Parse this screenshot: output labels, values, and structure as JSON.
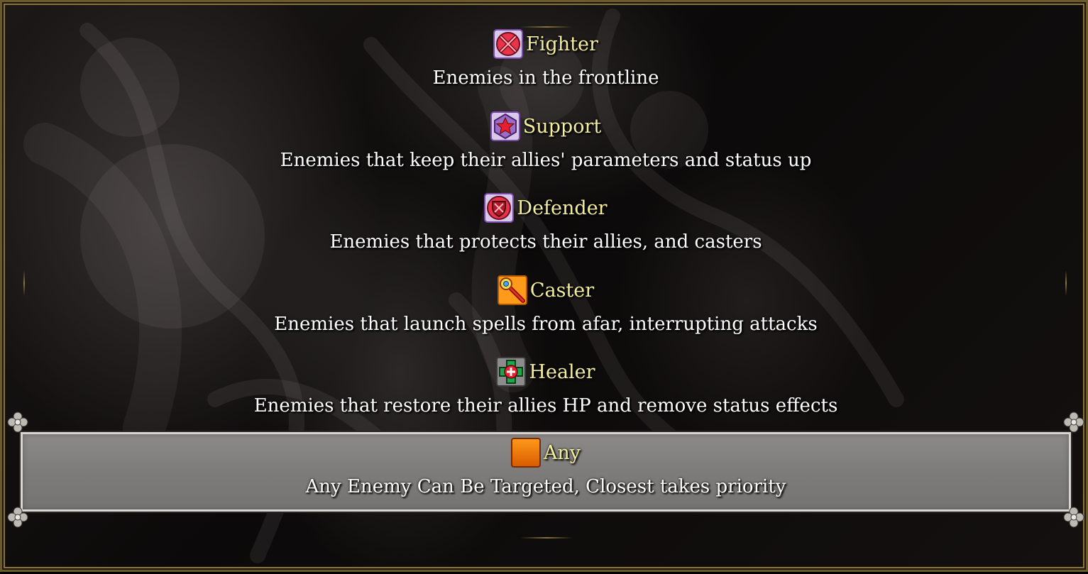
{
  "options": [
    {
      "title": "Fighter",
      "description": "Enemies in the frontline",
      "icon": "crossed-swords-icon",
      "selected": false
    },
    {
      "title": "Support",
      "description": "Enemies that keep their allies' parameters and status up",
      "icon": "star-emblem-icon",
      "selected": false
    },
    {
      "title": "Defender",
      "description": "Enemies that protects their allies, and casters",
      "icon": "shield-icon",
      "selected": false
    },
    {
      "title": "Caster",
      "description": "Enemies that launch spells from afar, interrupting attacks",
      "icon": "magic-staff-icon",
      "selected": false
    },
    {
      "title": "Healer",
      "description": "Enemies that restore their allies HP and remove status effects",
      "icon": "medical-cross-icon",
      "selected": false
    },
    {
      "title": "Any",
      "description": "Any Enemy Can Be Targeted, Closest takes priority",
      "icon": "orange-square-icon",
      "selected": true
    }
  ],
  "colors": {
    "title_text": "#f4ee9c",
    "description_text": "#ffffff",
    "frame_gold": "#8a7538",
    "selection_fill": "#807e7c",
    "selection_border": "#d8d6d2"
  }
}
